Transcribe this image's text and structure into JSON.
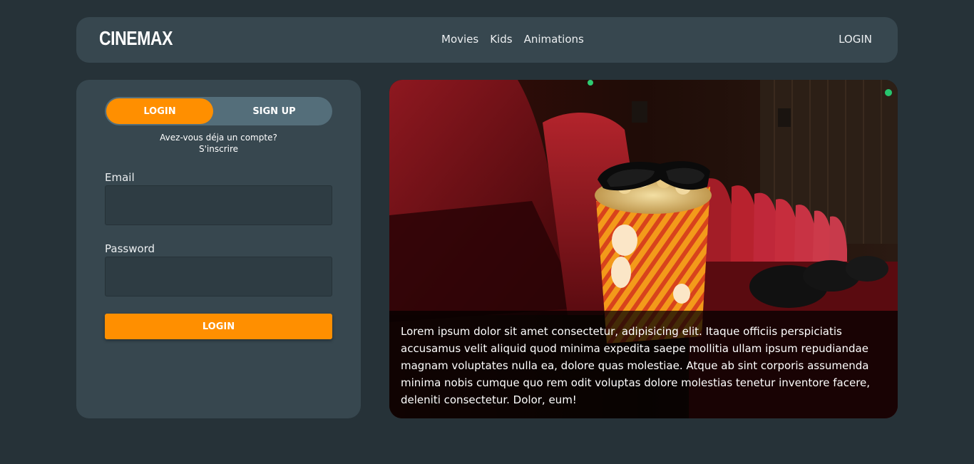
{
  "navbar": {
    "brand": "CINEMAX",
    "links": [
      "Movies",
      "Kids",
      "Animations"
    ],
    "login": "LOGIN"
  },
  "login_card": {
    "tab_login": "LOGIN",
    "tab_signup": "SIGN UP",
    "account_question": "Avez-vous déja un compte?",
    "account_link": "S'inscrire",
    "email_label": "Email",
    "email_value": "",
    "password_label": "Password",
    "password_value": "",
    "submit_label": "LOGIN"
  },
  "hero": {
    "caption": "Lorem ipsum dolor sit amet consectetur, adipisicing elit. Itaque officiis perspiciatis accusamus velit aliquid quod minima expedita saepe mollitia ullam ipsum repudiandae magnam voluptates nulla ea, dolore quas molestiae. Atque ab sint corporis assumenda minima nobis cumque quo rem odit voluptas dolore molestias tenetur inventore facere, deleniti consectetur. Dolor, eum!"
  },
  "colors": {
    "page_bg": "#263238",
    "card_bg": "#37474f",
    "accent": "#ff8f00",
    "toggle_bg": "#546e7a"
  }
}
